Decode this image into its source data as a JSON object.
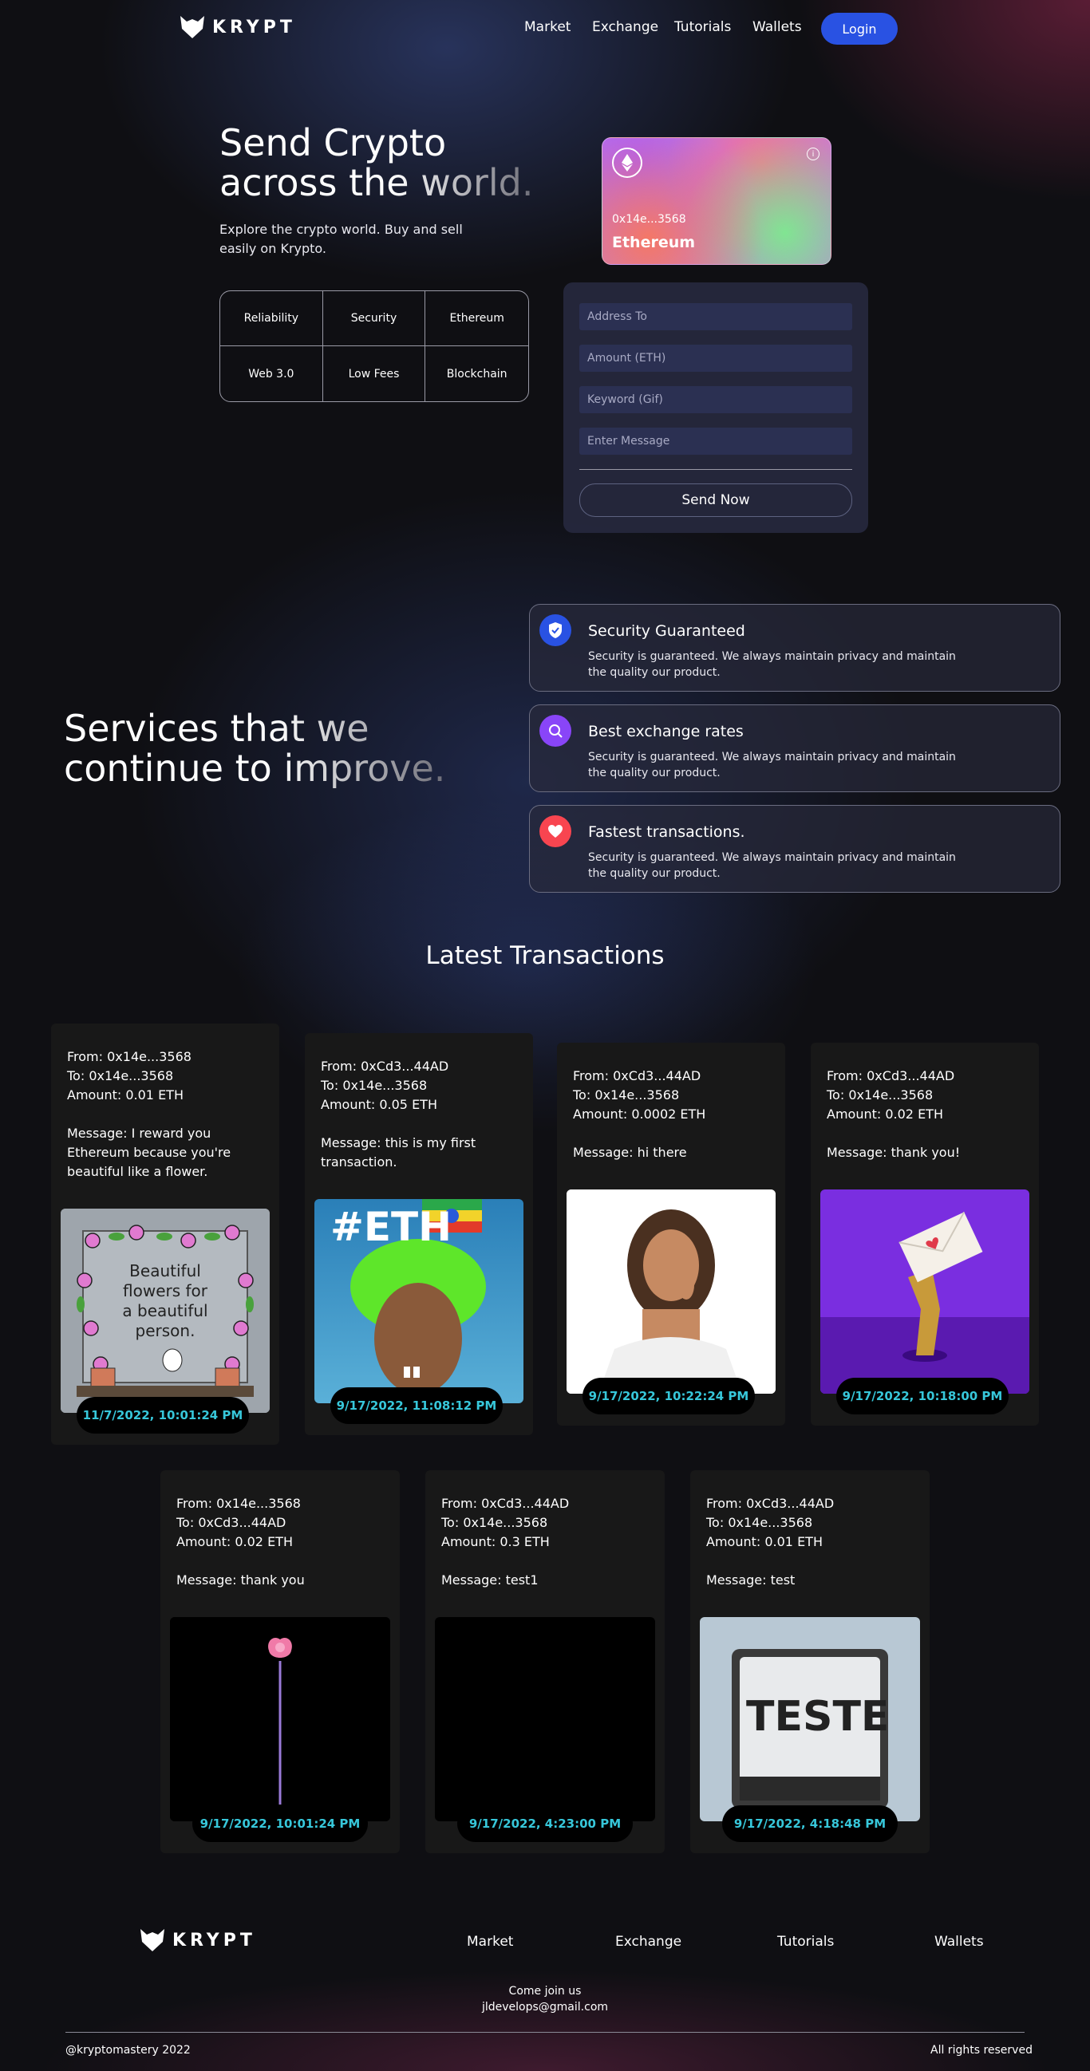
{
  "nav": {
    "brand": "KRYPT",
    "links": [
      "Market",
      "Exchange",
      "Tutorials",
      "Wallets"
    ],
    "login": "Login"
  },
  "hero": {
    "title_line1": "Send Crypto",
    "title_line2": "across the world.",
    "subtitle_line1": "Explore the crypto world. Buy and sell",
    "subtitle_line2": "easily on Krypto.",
    "features": [
      "Reliability",
      "Security",
      "Ethereum",
      "Web 3.0",
      "Low Fees",
      "Blockchain"
    ]
  },
  "eth_card": {
    "address": "0x14e...3568",
    "network": "Ethereum"
  },
  "send_form": {
    "address_placeholder": "Address To",
    "amount_placeholder": "Amount (ETH)",
    "keyword_placeholder": "Keyword (Gif)",
    "message_placeholder": "Enter Message",
    "submit": "Send Now"
  },
  "services": {
    "title_line1": "Services that we",
    "title_line2": "continue to improve.",
    "cards": [
      {
        "title": "Security Guaranteed",
        "text_line1": "Security is guaranteed. We always maintain privacy and maintain",
        "text_line2": "the quality our product.",
        "icon": "shield-icon",
        "color": "#2952e3"
      },
      {
        "title": "Best exchange rates",
        "text_line1": "Security is guaranteed. We always maintain privacy and maintain",
        "text_line2": "the quality our product.",
        "icon": "search-icon",
        "color": "#8945f8"
      },
      {
        "title": "Fastest transactions.",
        "text_line1": "Security is guaranteed. We always maintain privacy and maintain",
        "text_line2": "the quality our product.",
        "icon": "heart-icon",
        "color": "#f84550"
      }
    ]
  },
  "transactions": {
    "heading": "Latest Transactions",
    "items": [
      {
        "from": "From: 0x14e...3568",
        "to": "To: 0x14e...3568",
        "amount": "Amount: 0.01 ETH",
        "message": "Message: I reward you Ethereum because you're beautiful like a flower.",
        "time": "11/7/2022, 10:01:24 PM",
        "image_text": "Beautiful flowers for a beautiful person."
      },
      {
        "from": "From: 0xCd3...44AD",
        "to": "To: 0x14e...3568",
        "amount": "Amount: 0.05 ETH",
        "message": "Message: this is my first transaction.",
        "time": "9/17/2022, 11:08:12 PM",
        "image_text": "#ETH"
      },
      {
        "from": "From: 0xCd3...44AD",
        "to": "To: 0x14e...3568",
        "amount": "Amount: 0.0002 ETH",
        "message": "Message: hi there",
        "time": "9/17/2022, 10:22:24 PM",
        "image_text": ""
      },
      {
        "from": "From: 0xCd3...44AD",
        "to": "To: 0x14e...3568",
        "amount": "Amount: 0.02 ETH",
        "message": "Message: thank you!",
        "time": "9/17/2022, 10:18:00 PM",
        "image_text": ""
      },
      {
        "from": "From: 0x14e...3568",
        "to": "To: 0xCd3...44AD",
        "amount": "Amount: 0.02 ETH",
        "message": "Message: thank you",
        "time": "9/17/2022, 10:01:24 PM",
        "image_text": ""
      },
      {
        "from": "From: 0xCd3...44AD",
        "to": "To: 0x14e...3568",
        "amount": "Amount: 0.3 ETH",
        "message": "Message: test1",
        "time": "9/17/2022, 4:23:00 PM",
        "image_text": ""
      },
      {
        "from": "From: 0xCd3...44AD",
        "to": "To: 0x14e...3568",
        "amount": "Amount: 0.01 ETH",
        "message": "Message: test",
        "time": "9/17/2022, 4:18:48 PM",
        "image_text": "TESTE"
      }
    ]
  },
  "footer": {
    "brand": "KRYPT",
    "links": [
      "Market",
      "Exchange",
      "Tutorials",
      "Wallets"
    ],
    "join": "Come join us",
    "email": "jldevelops@gmail.com",
    "handle": "@kryptomastery 2022",
    "rights": "All rights reserved"
  }
}
